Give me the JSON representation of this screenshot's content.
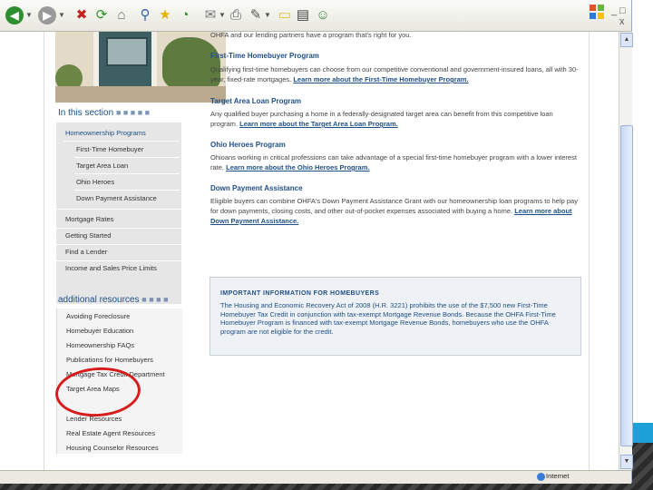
{
  "window_controls": {
    "minimize": "_",
    "maximize": "□",
    "close": "x"
  },
  "toolbar": {
    "icons": [
      "back-arrow-icon",
      "forward-arrow-icon",
      "stop-icon",
      "refresh-icon",
      "home-icon",
      "search-icon",
      "favorites-star-icon",
      "history-icon",
      "mail-icon",
      "print-icon",
      "edit-icon",
      "discuss-icon",
      "research-icon",
      "messenger-icon"
    ]
  },
  "sidebar": {
    "section_title": "In this section",
    "items": [
      {
        "label": "Homeownership Programs",
        "level": 0,
        "active": true
      },
      {
        "label": "First-Time Homebuyer",
        "level": 1
      },
      {
        "label": "Target Area Loan",
        "level": 1
      },
      {
        "label": "Ohio Heroes",
        "level": 1
      },
      {
        "label": "Down Payment Assistance",
        "level": 1
      },
      {
        "label": "Mortgage Rates",
        "level": 0
      },
      {
        "label": "Getting Started",
        "level": 0
      },
      {
        "label": "Find a Lender",
        "level": 0
      },
      {
        "label": "Income and Sales Price Limits",
        "level": 0
      }
    ],
    "resources_title": "additional resources",
    "resources": [
      "Avoiding Foreclosure",
      "Homebuyer Education",
      "Homeownership FAQs",
      "Publications for Homebuyers",
      "Mortgage Tax Credit Department",
      "Target Area Maps",
      "Lender Resources",
      "Real Estate Agent Resources",
      "Housing Counselor Resources"
    ]
  },
  "main": {
    "intro_tail": "OHFA and our lending partners have a program that's right for you.",
    "sections": [
      {
        "heading": "First-Time Homebuyer Program",
        "body": "Qualifying first-time homebuyers can choose from our competitive conventional and government-insured loans, all with 30-year, fixed-rate mortgages.",
        "link": "Learn more about the First-Time Homebuyer Program."
      },
      {
        "heading": "Target Area Loan Program",
        "body": "Any qualified buyer purchasing a home in a federally-designated target area can benefit from this competitive loan program.",
        "link": "Learn more about the Target Area Loan Program."
      },
      {
        "heading": "Ohio Heroes Program",
        "body": "Ohioans working in critical professions can take advantage of a special first-time homebuyer program with a lower interest rate.",
        "link": "Learn more about the Ohio Heroes Program."
      },
      {
        "heading": "Down Payment Assistance",
        "body": "Eligible buyers can combine OHFA's Down Payment Assistance Grant with our homeownership loan programs to help pay for down payments, closing costs, and other out-of-pocket expenses associated with buying a home.",
        "link": "Learn more about Down Payment Assistance."
      }
    ],
    "notice": {
      "heading": "IMPORTANT INFORMATION FOR HOMEBUYERS",
      "body": "The Housing and Economic Recovery Act of 2008 (H.R. 3221) prohibits the use of the $7,500 new First-Time Homebuyer Tax Credit in conjunction with tax-exempt Mortgage Revenue Bonds. Because the OHFA First-Time Homebuyer Program is financed with tax-exempt Mortgage Revenue Bonds, homebuyers who use the OHFA program are not eligible for the credit."
    }
  },
  "status_bar": {
    "zone": "Internet"
  },
  "annotation_color": "#d61c1c"
}
